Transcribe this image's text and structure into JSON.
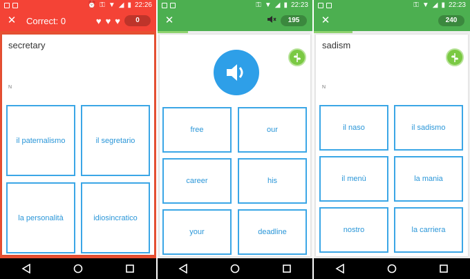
{
  "colors": {
    "panel1_header": "#f44336",
    "panel1_bottom": "#e85032",
    "green_header": "#4caf50",
    "option_border": "#3aa6e6",
    "option_text": "#2a96d8",
    "speaker_blue": "#2e9fe8",
    "leaf_green": "#7ac943"
  },
  "panels": [
    {
      "status_time": "22:26",
      "header": {
        "title": "Correct: 0",
        "score": "0",
        "hearts": 3
      },
      "word": "secretary",
      "part_of_speech": "N",
      "options": [
        "il paternalismo",
        "il segretario",
        "la personalità",
        "idiosincratico"
      ]
    },
    {
      "status_time": "22:23",
      "header": {
        "score": "195",
        "mute_icon": "mute-icon"
      },
      "prompt_icon": "speaker-icon",
      "options": [
        "free",
        "our",
        "career",
        "his",
        "your",
        "deadline"
      ]
    },
    {
      "status_time": "22:23",
      "header": {
        "score": "240"
      },
      "word": "sadism",
      "part_of_speech": "N",
      "options": [
        "il naso",
        "il sadismo",
        "il menù",
        "la mania",
        "nostro",
        "la carriera"
      ]
    }
  ],
  "nav": {
    "buttons": [
      "back-icon",
      "home-icon",
      "recents-icon"
    ]
  }
}
